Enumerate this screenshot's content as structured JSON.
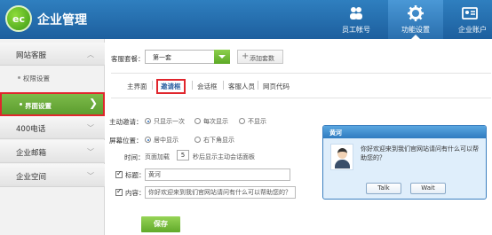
{
  "app": {
    "logo_text": "ec",
    "title": "企业管理"
  },
  "topnav": [
    {
      "label": "员工帐号",
      "icon": "people-icon"
    },
    {
      "label": "功能设置",
      "icon": "gear-icon",
      "active": true
    },
    {
      "label": "企业账户",
      "icon": "id-card-icon"
    }
  ],
  "sidebar": {
    "groups": [
      {
        "label": "网站客服",
        "chevron": "︿"
      },
      {
        "label": "400电话",
        "chevron": "﹀"
      },
      {
        "label": "企业邮箱",
        "chevron": "﹀"
      },
      {
        "label": "企业空间",
        "chevron": "﹀"
      }
    ],
    "items": [
      {
        "label": "权限设置"
      },
      {
        "label": "界面设置",
        "active": true,
        "arrow": "❯"
      }
    ]
  },
  "main": {
    "plan_label": "客服套餐：",
    "plan_value": "第一套",
    "add_plan": {
      "plus": "+",
      "label": "添加套数"
    },
    "tabs": [
      "主界面",
      "邀请框",
      "会话框",
      "客服人员",
      "网页代码"
    ],
    "active_tab": "邀请框",
    "auto_invite": {
      "label": "主动邀请：",
      "options": [
        "只显示一次",
        "每次显示",
        "不显示"
      ],
      "selected": "只显示一次"
    },
    "screen_position": {
      "label": "屏幕位置：",
      "options": [
        "居中显示",
        "右下角显示"
      ],
      "selected": "居中显示"
    },
    "time": {
      "label": "时间：",
      "prefix": "页面加载",
      "value": "5",
      "suffix": "秒后显示主动会话面板"
    },
    "title_field": {
      "label": "标题：",
      "value": "黄河"
    },
    "content_field": {
      "label": "内容：",
      "value": "你好欢迎来到我们官网站请问有什么可以帮助您的？"
    },
    "save_label": "保存"
  },
  "preview": {
    "title": "黄河",
    "message": "你好欢迎来到我们官网站请问有什么可以帮助您的？",
    "talk_label": "Talk",
    "wait_label": "Wait"
  },
  "colors": {
    "header": "#2f7fbf",
    "accent_green": "#6db33f",
    "highlight_red": "#e0262d"
  }
}
